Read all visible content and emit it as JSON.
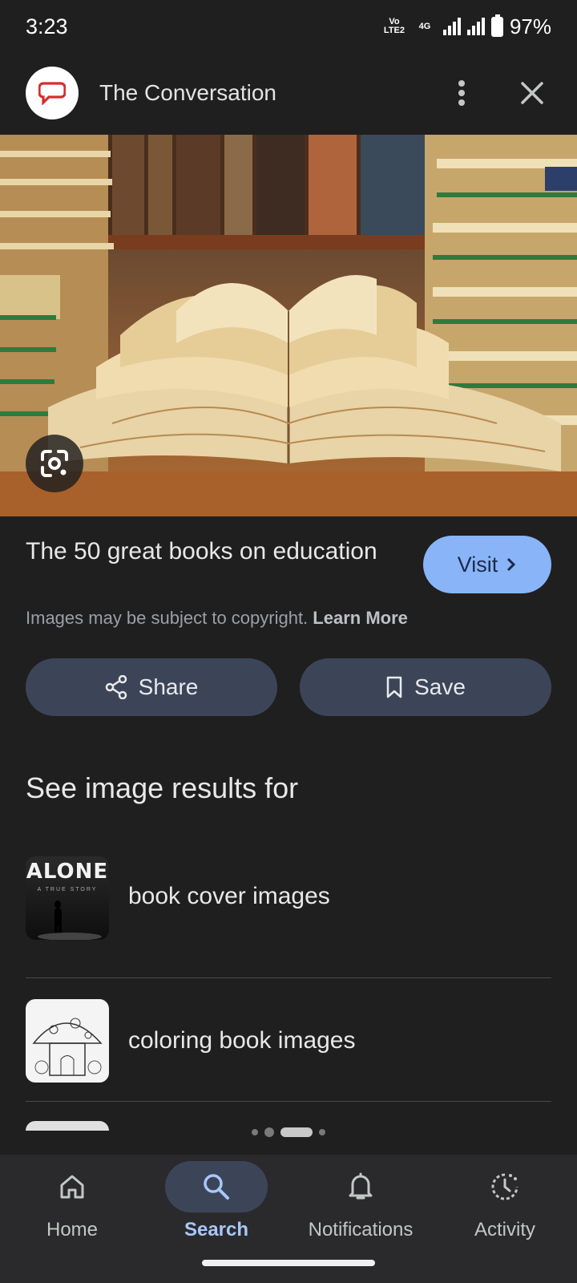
{
  "status_bar": {
    "time": "3:23",
    "network_badge": "Vo LTE2",
    "network_type": "4G",
    "battery": "97%"
  },
  "header": {
    "source_name": "The Conversation",
    "logo_icon": "speech-bubble-icon"
  },
  "result": {
    "title": "The 50 great books on education",
    "visit_label": "Visit",
    "copyright_text": "Images may be subject to copyright.",
    "learn_more": "Learn More"
  },
  "actions": {
    "share_label": "Share",
    "save_label": "Save"
  },
  "related": {
    "heading": "See image results for",
    "items": [
      {
        "label": "book cover images",
        "thumb_text": "ALONE",
        "thumb_subtext": "A TRUE STORY"
      },
      {
        "label": "coloring book images"
      }
    ]
  },
  "bottom_nav": {
    "items": [
      {
        "label": "Home",
        "icon": "home-icon"
      },
      {
        "label": "Search",
        "icon": "search-icon",
        "active": true
      },
      {
        "label": "Notifications",
        "icon": "bell-icon"
      },
      {
        "label": "Activity",
        "icon": "activity-icon"
      }
    ]
  },
  "colors": {
    "background": "#1f1f1f",
    "accent": "#8ab4f8",
    "button_bg": "#3c4558",
    "brand_red": "#d32f2f"
  }
}
